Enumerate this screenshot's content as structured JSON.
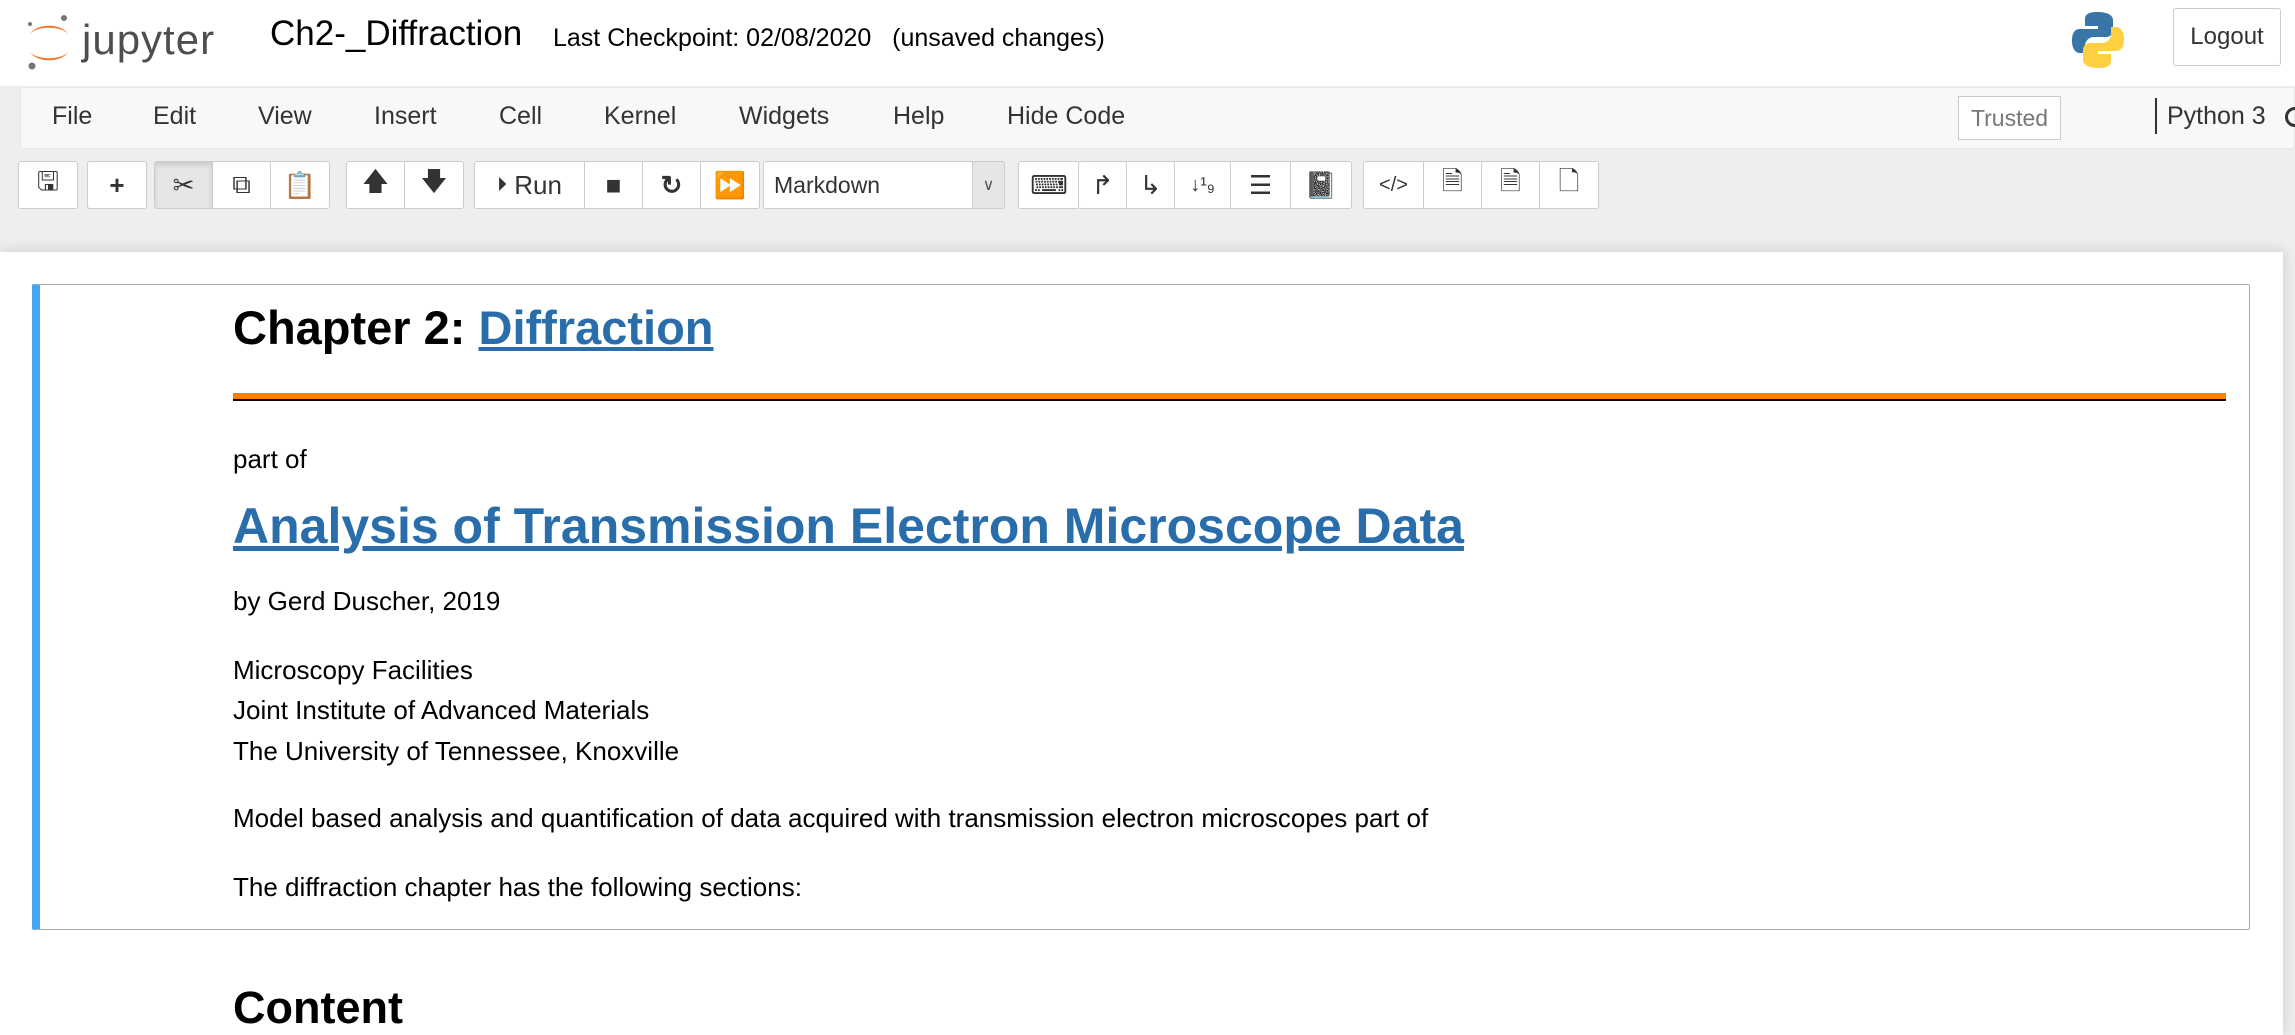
{
  "header": {
    "logo_text": "jupyter",
    "notebook_title": "Ch2-_Diffraction",
    "checkpoint": "Last Checkpoint: 02/08/2020",
    "status": "(unsaved changes)",
    "logout_label": "Logout"
  },
  "menubar": {
    "items": [
      "File",
      "Edit",
      "View",
      "Insert",
      "Cell",
      "Kernel",
      "Widgets",
      "Help",
      "Hide Code"
    ],
    "trusted_label": "Trusted",
    "kernel_name": "Python 3"
  },
  "toolbar": {
    "run_label": "Run",
    "cell_type": "Markdown",
    "icons": [
      "save-icon",
      "plus-icon",
      "cut-icon",
      "copy-icon",
      "paste-icon",
      "arrow-up-icon",
      "arrow-down-icon",
      "run-icon",
      "stop-icon",
      "restart-icon",
      "fast-forward-icon",
      "keyboard-icon",
      "move-up-icon",
      "move-down-icon",
      "numbered-sort-icon",
      "list-icon",
      "book-icon",
      "code-icon",
      "file-text-icon",
      "file-pdf-icon",
      "file-icon"
    ]
  },
  "cell": {
    "heading_prefix": "Chapter 2: ",
    "heading_link": "Diffraction",
    "part_of": "part of",
    "book_title": "Analysis of Transmission Electron Microscope Data",
    "author": "by Gerd Duscher, 2019",
    "affiliation": [
      "Microscopy Facilities",
      "Joint Institute of Advanced Materials",
      "The University of Tennessee, Knoxville"
    ],
    "description": "Model based analysis and quantification of data acquired with transmission electron microscopes part of",
    "sections_intro": "The diffraction chapter has the following sections:"
  },
  "content_heading": "Content",
  "colors": {
    "accent_orange": "#ff8000",
    "link_blue": "#296eaa",
    "cell_selected": "#42a5f5"
  }
}
